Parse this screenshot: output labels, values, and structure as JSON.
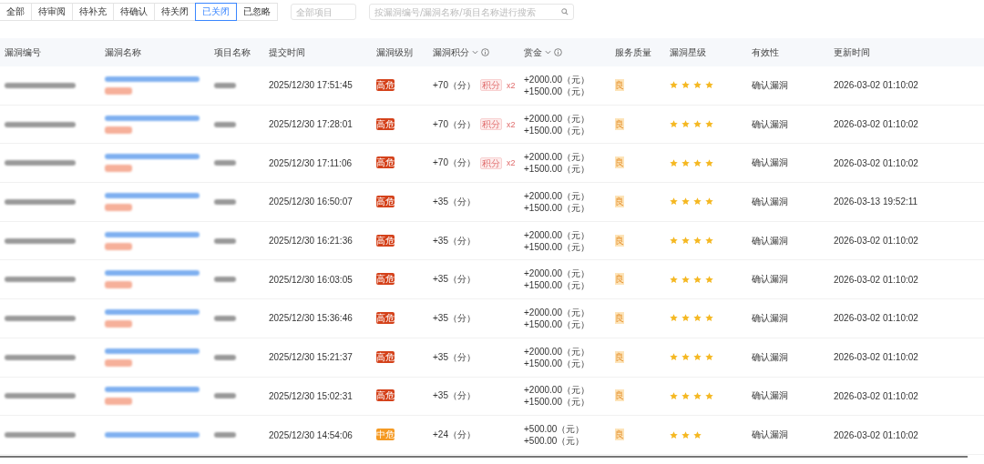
{
  "tabs": [
    {
      "label": "全部",
      "selected": false
    },
    {
      "label": "待审阅",
      "selected": false
    },
    {
      "label": "待补充",
      "selected": false
    },
    {
      "label": "待确认",
      "selected": false
    },
    {
      "label": "待关闭",
      "selected": false
    },
    {
      "label": "已关闭",
      "selected": true
    },
    {
      "label": "已忽略",
      "selected": false
    }
  ],
  "project_filter": {
    "placeholder": "全部项目"
  },
  "search": {
    "placeholder": "按漏洞编号/漏洞名称/项目名称进行搜索"
  },
  "table": {
    "columns": [
      {
        "label": "漏洞编号",
        "kind": "plain"
      },
      {
        "label": "漏洞名称",
        "kind": "plain"
      },
      {
        "label": "项目名称",
        "kind": "plain"
      },
      {
        "label": "提交时间",
        "kind": "plain"
      },
      {
        "label": "漏洞级别",
        "kind": "plain"
      },
      {
        "label": "漏洞积分",
        "kind": "sortable"
      },
      {
        "label": "赏金",
        "kind": "sortable"
      },
      {
        "label": "服务质量",
        "kind": "plain"
      },
      {
        "label": "漏洞星级",
        "kind": "plain"
      },
      {
        "label": "有效性",
        "kind": "plain"
      },
      {
        "label": "更新时间",
        "kind": "plain"
      }
    ],
    "rows": [
      {
        "name_tagged": true,
        "submitted": "2025/12/30 17:51:45",
        "level": "高危",
        "color": "#d4411a",
        "points": "+70（分）",
        "points_tag": "积分",
        "points_multiplier": "x2",
        "bounty": "+2000.00（元） +1500.00（元）",
        "quality": "良",
        "stars": 4,
        "validity": "确认漏洞",
        "updated": "2026-03-02 01:10:02"
      },
      {
        "name_tagged": true,
        "submitted": "2025/12/30 17:28:01",
        "level": "高危",
        "color": "#d4411a",
        "points": "+70（分）",
        "points_tag": "积分",
        "points_multiplier": "x2",
        "bounty": "+2000.00（元） +1500.00（元）",
        "quality": "良",
        "stars": 4,
        "validity": "确认漏洞",
        "updated": "2026-03-02 01:10:02"
      },
      {
        "name_tagged": true,
        "submitted": "2025/12/30 17:11:06",
        "level": "高危",
        "color": "#d4411a",
        "points": "+70（分）",
        "points_tag": "积分",
        "points_multiplier": "x2",
        "bounty": "+2000.00（元） +1500.00（元）",
        "quality": "良",
        "stars": 4,
        "validity": "确认漏洞",
        "updated": "2026-03-02 01:10:02"
      },
      {
        "name_tagged": true,
        "submitted": "2025/12/30 16:50:07",
        "level": "高危",
        "color": "#d4411a",
        "points": "+35（分）",
        "bounty": "+2000.00（元） +1500.00（元）",
        "quality": "良",
        "stars": 4,
        "validity": "确认漏洞",
        "updated": "2026-03-13 19:52:11"
      },
      {
        "name_tagged": true,
        "submitted": "2025/12/30 16:21:36",
        "level": "高危",
        "color": "#d4411a",
        "points": "+35（分）",
        "bounty": "+2000.00（元） +1500.00（元）",
        "quality": "良",
        "stars": 4,
        "validity": "确认漏洞",
        "updated": "2026-03-02 01:10:02"
      },
      {
        "name_tagged": true,
        "submitted": "2025/12/30 16:03:05",
        "level": "高危",
        "color": "#d4411a",
        "points": "+35（分）",
        "bounty": "+2000.00（元） +1500.00（元）",
        "quality": "良",
        "stars": 4,
        "validity": "确认漏洞",
        "updated": "2026-03-02 01:10:02"
      },
      {
        "name_tagged": true,
        "submitted": "2025/12/30 15:36:46",
        "level": "高危",
        "color": "#d4411a",
        "points": "+35（分）",
        "bounty": "+2000.00（元） +1500.00（元）",
        "quality": "良",
        "stars": 4,
        "validity": "确认漏洞",
        "updated": "2026-03-02 01:10:02"
      },
      {
        "name_tagged": true,
        "submitted": "2025/12/30 15:21:37",
        "level": "高危",
        "color": "#d4411a",
        "points": "+35（分）",
        "bounty": "+2000.00（元） +1500.00（元）",
        "quality": "良",
        "stars": 4,
        "validity": "确认漏洞",
        "updated": "2026-03-02 01:10:02"
      },
      {
        "name_tagged": true,
        "submitted": "2025/12/30 15:02:31",
        "level": "高危",
        "color": "#d4411a",
        "points": "+35（分）",
        "bounty": "+2000.00（元） +1500.00（元）",
        "quality": "良",
        "stars": 4,
        "validity": "确认漏洞",
        "updated": "2026-03-02 01:10:02"
      },
      {
        "name_tagged": false,
        "submitted": "2025/12/30 14:54:06",
        "level": "中危",
        "color": "#f59a23",
        "points": "+24（分）",
        "bounty": "+500.00（元） +500.00（元）",
        "quality": "良",
        "stars": 3,
        "validity": "确认漏洞",
        "updated": "2026-03-02 01:10:02"
      }
    ]
  }
}
